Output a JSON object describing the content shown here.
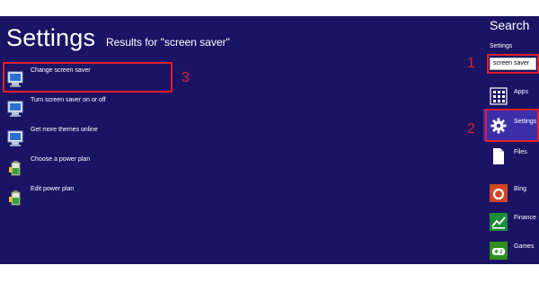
{
  "results_pane": {
    "title": "Settings",
    "results_for": "Results for \"screen saver\"",
    "results": [
      {
        "label": "Change screen saver",
        "icon": "monitor-settings-icon"
      },
      {
        "label": "Turn screen saver on or off",
        "icon": "monitor-settings-icon"
      },
      {
        "label": "Get more themes online",
        "icon": "monitor-settings-icon"
      },
      {
        "label": "Choose a power plan",
        "icon": "battery-icon"
      },
      {
        "label": "Edit power plan",
        "icon": "battery-icon"
      }
    ]
  },
  "search_pane": {
    "title": "Search",
    "subtitle": "Settings",
    "query": "screen saver",
    "scopes": [
      {
        "label": "Apps",
        "icon": "apps-grid-icon"
      },
      {
        "label": "Settings",
        "icon": "gear-icon"
      },
      {
        "label": "Files",
        "icon": "document-icon"
      },
      {
        "label": "Bing",
        "icon": "bing-icon"
      },
      {
        "label": "Finance",
        "icon": "finance-chart-icon"
      },
      {
        "label": "Games",
        "icon": "games-icon"
      }
    ]
  },
  "annotations": {
    "step1": "1",
    "step2": "2",
    "step3": "3"
  },
  "colors": {
    "background": "#1b1464",
    "annotation_red": "#e0202c",
    "bing_orange": "#d24726",
    "finance_green": "#1e8c3a",
    "games_green": "#2f8f1f"
  }
}
